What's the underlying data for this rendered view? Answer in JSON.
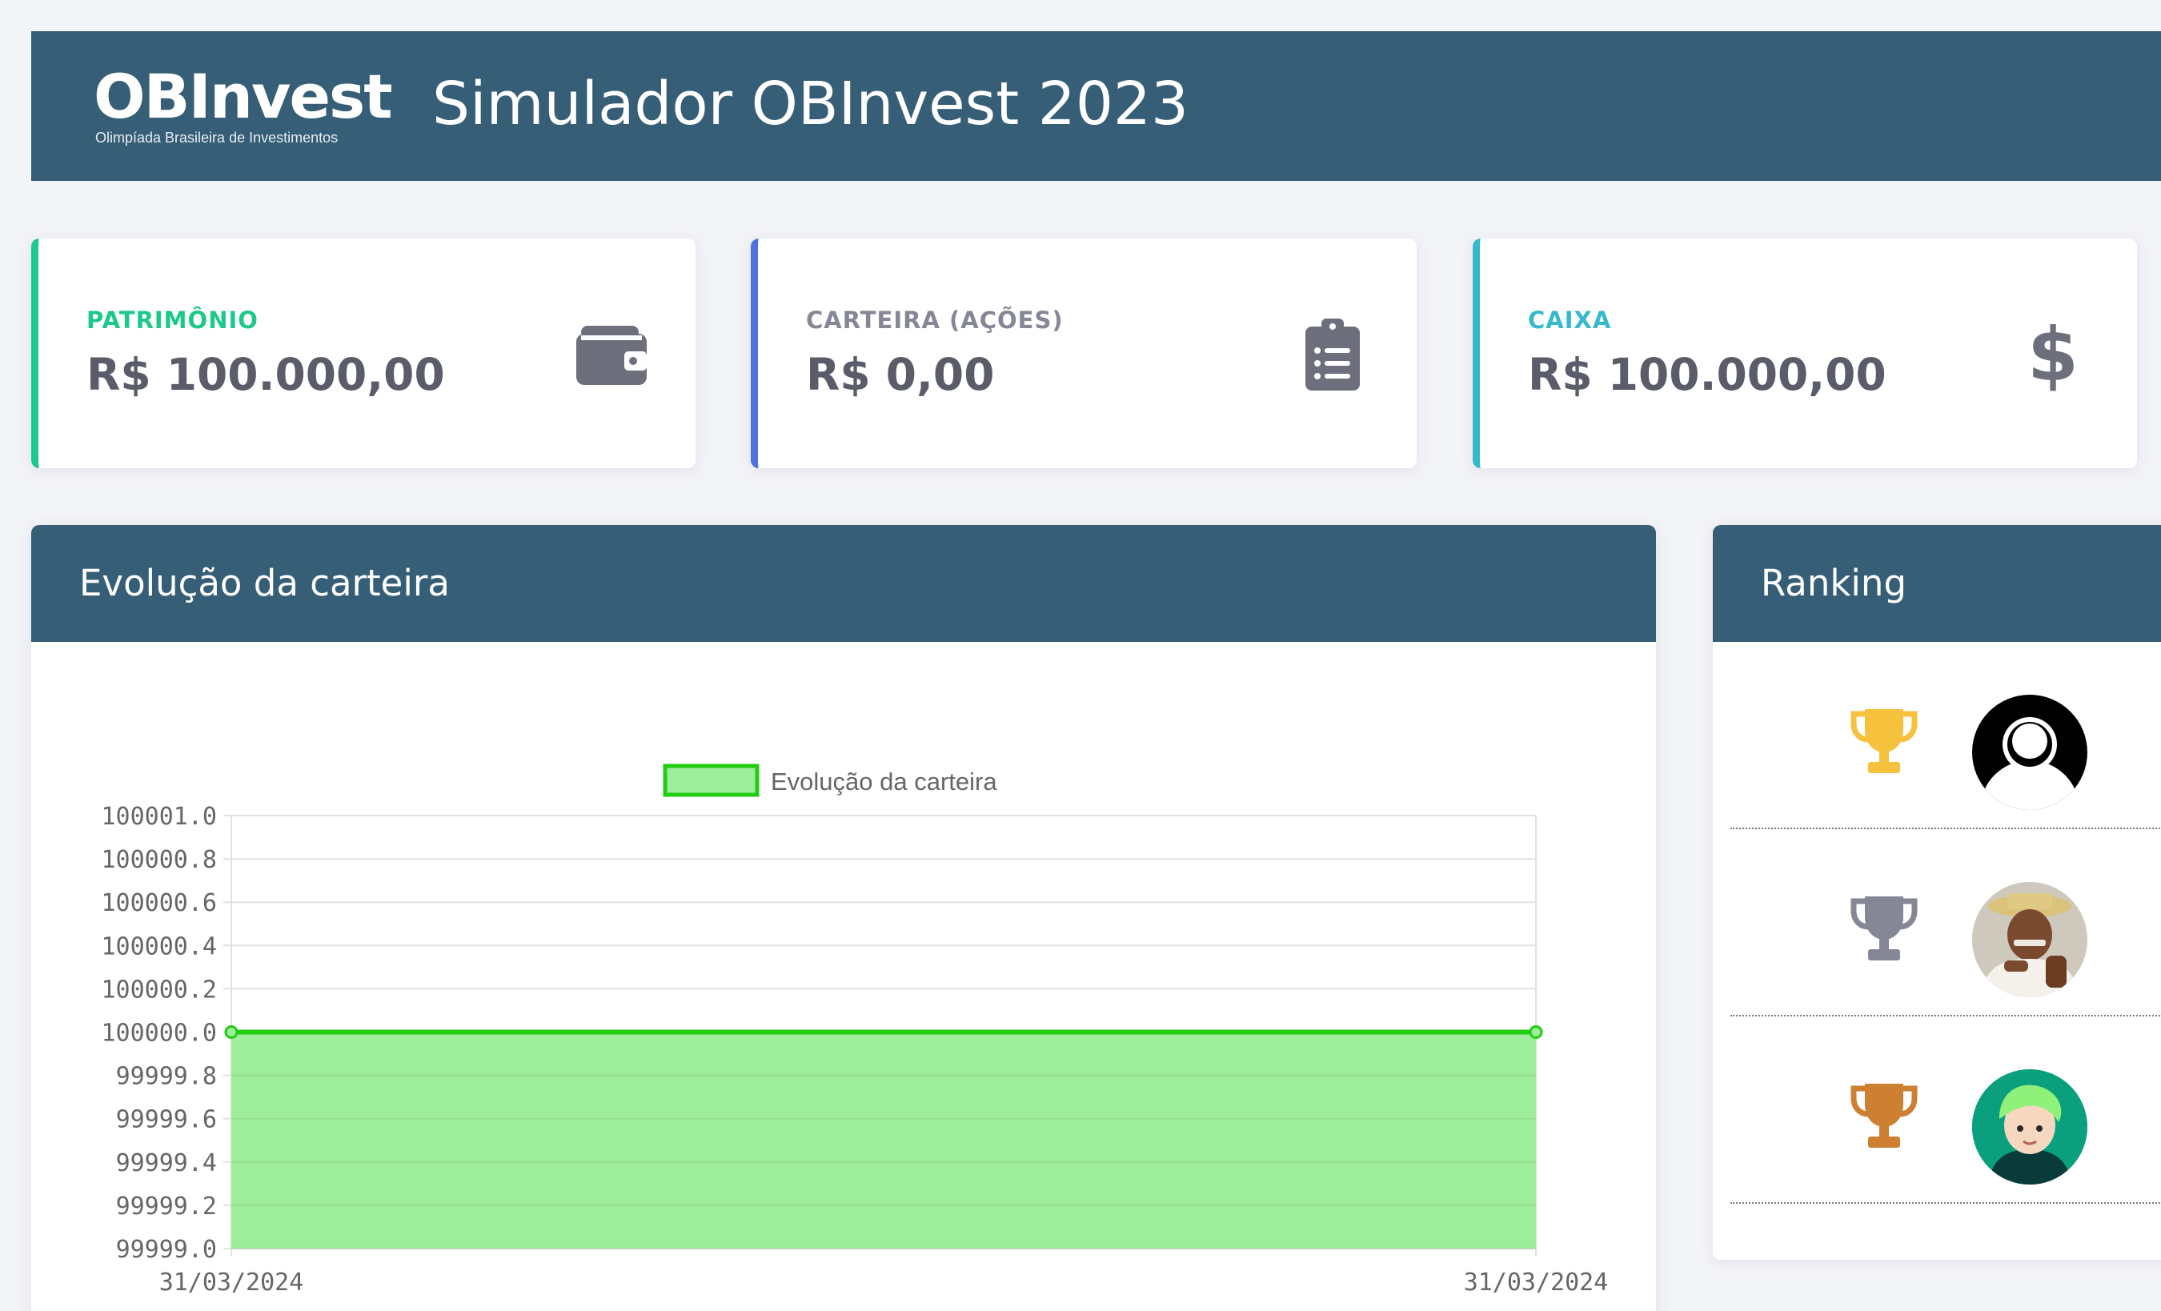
{
  "header": {
    "logo_text": "OBInvest",
    "logo_subtitle": "Olimpíada Brasileira de Investimentos",
    "title": "Simulador OBInvest 2023"
  },
  "cards": [
    {
      "label": "PATRIMÔNIO",
      "value": "R$ 100.000,00",
      "icon": "wallet-icon",
      "accent": "#1cc88a"
    },
    {
      "label": "CARTEIRA (AÇÕES)",
      "value": "R$ 0,00",
      "icon": "clipboard-list-icon",
      "accent": "#4e73df"
    },
    {
      "label": "CAIXA",
      "value": "R$ 100.000,00",
      "icon": "dollar-sign-icon",
      "accent": "#36b9cc"
    }
  ],
  "chart_panel": {
    "title": "Evolução da carteira"
  },
  "chart_data": {
    "type": "area",
    "legend": [
      "Evolução da carteira"
    ],
    "legend_position": "top",
    "x": [
      "31/03/2024",
      "31/03/2024"
    ],
    "series": [
      {
        "name": "Evolução da carteira",
        "values": [
          100000.0,
          100000.0
        ],
        "color": "#22cc11",
        "fill": "#9ded9a"
      }
    ],
    "y_ticks": [
      "100001.0",
      "100000.8",
      "100000.6",
      "100000.4",
      "100000.2",
      "100000.0",
      "99999.8",
      "99999.6",
      "99999.4",
      "99999.2",
      "99999.0"
    ],
    "ylim": [
      99999.0,
      100001.0
    ],
    "grid": true
  },
  "ranking_panel": {
    "title": "Ranking",
    "entries": [
      {
        "trophy": "gold-trophy-icon",
        "trophy_color": "#f6c23e",
        "avatar": "default-avatar"
      },
      {
        "trophy": "silver-trophy-icon",
        "trophy_color": "#858796",
        "avatar": "user-photo-avatar"
      },
      {
        "trophy": "bronze-trophy-icon",
        "trophy_color": "#cd7f32",
        "avatar": "cartoon-avatar"
      }
    ]
  },
  "colors": {
    "header_bg": "#365f77",
    "page_bg": "#f3f4f8",
    "text_dark": "#5a5c69",
    "icon_gray": "#6e6f7d"
  }
}
